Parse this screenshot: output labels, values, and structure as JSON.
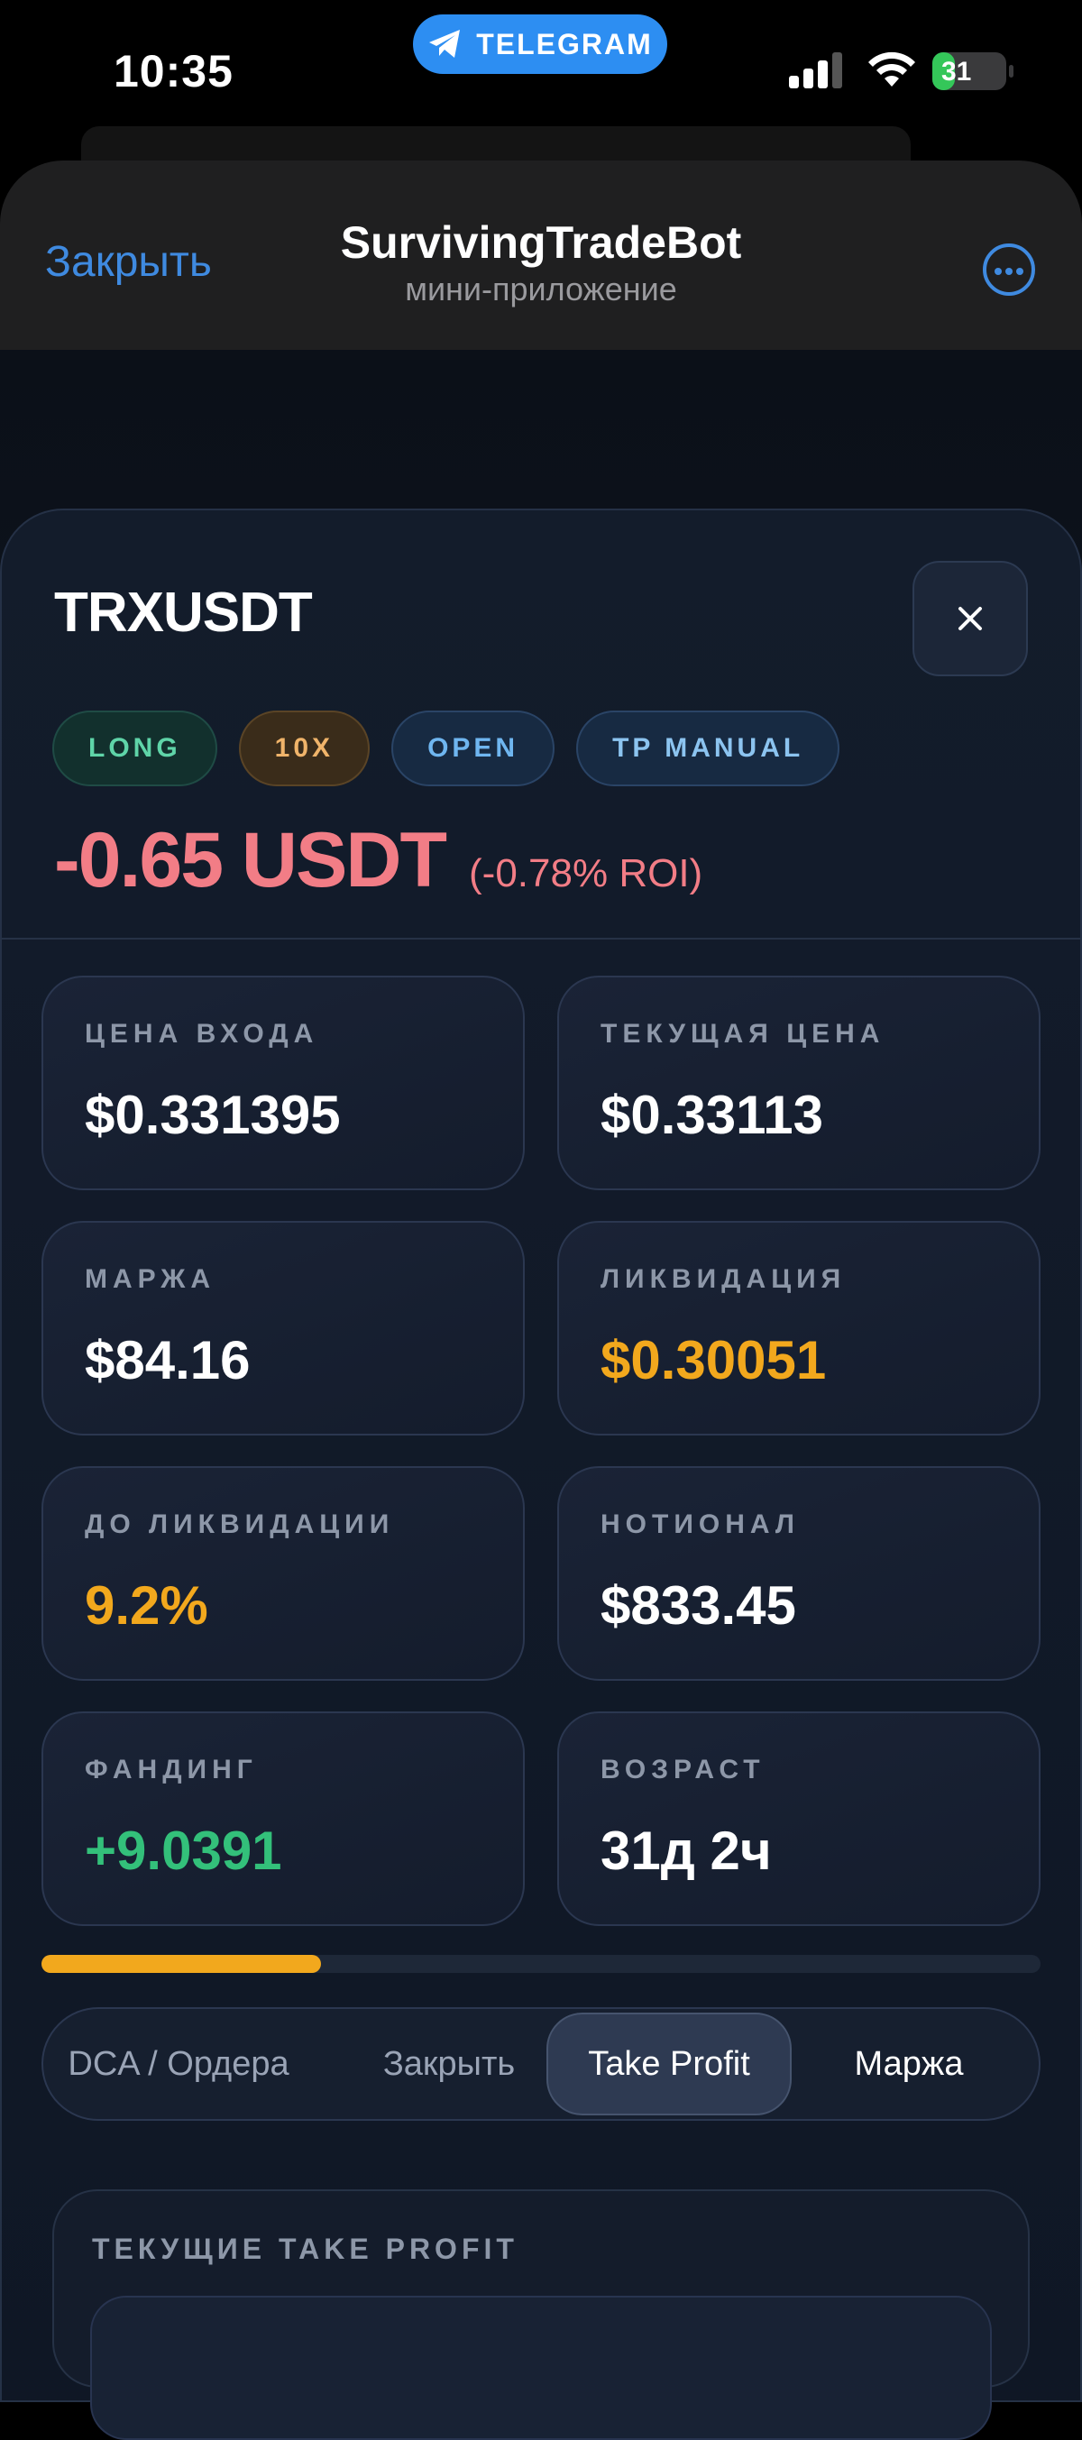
{
  "status_bar": {
    "time": "10:35",
    "telegram_label": "TELEGRAM",
    "battery": "31"
  },
  "telegram_header": {
    "close_label": "Закрыть",
    "title": "SurvivingTradeBot",
    "subtitle": "мини-приложение",
    "more_icon": "ellipsis-icon"
  },
  "position": {
    "pair": "TRXUSDT",
    "close_icon": "close-icon",
    "tags": [
      {
        "label": "LONG",
        "style": "long"
      },
      {
        "label": "10X",
        "style": "leverage"
      },
      {
        "label": "OPEN",
        "style": "open"
      },
      {
        "label": "TP MANUAL",
        "style": "tp"
      }
    ],
    "pnl": "-0.65 USDT",
    "roi": "(-0.78% ROI)",
    "colors": {
      "loss": "#f27d86",
      "warning": "#f2a81d",
      "positive": "#33c07a"
    }
  },
  "stats": [
    {
      "label": "ЦЕНА ВХОДА",
      "value": "$0.331395",
      "tone": "normal"
    },
    {
      "label": "ТЕКУЩАЯ ЦЕНА",
      "value": "$0.33113",
      "tone": "normal"
    },
    {
      "label": "МАРЖА",
      "value": "$84.16",
      "tone": "normal"
    },
    {
      "label": "ЛИКВИДАЦИЯ",
      "value": "$0.30051",
      "tone": "warn"
    },
    {
      "label": "ДО ЛИКВИДАЦИИ",
      "value": "9.2%",
      "tone": "warn"
    },
    {
      "label": "НОТИОНАЛ",
      "value": "$833.45",
      "tone": "normal"
    },
    {
      "label": "ФАНДИНГ",
      "value": "+9.0391",
      "tone": "good"
    },
    {
      "label": "ВОЗРАСТ",
      "value": "31д 2ч",
      "tone": "normal"
    }
  ],
  "progress": {
    "fraction": 0.28
  },
  "tabs": [
    {
      "label": "DCA / Ордера",
      "active": false
    },
    {
      "label": "Закрыть",
      "active": false
    },
    {
      "label": "Take Profit",
      "active": true
    },
    {
      "label": "Маржа",
      "active": false
    }
  ],
  "take_profit_section": {
    "header": "ТЕКУЩИЕ TAKE PROFIT"
  }
}
